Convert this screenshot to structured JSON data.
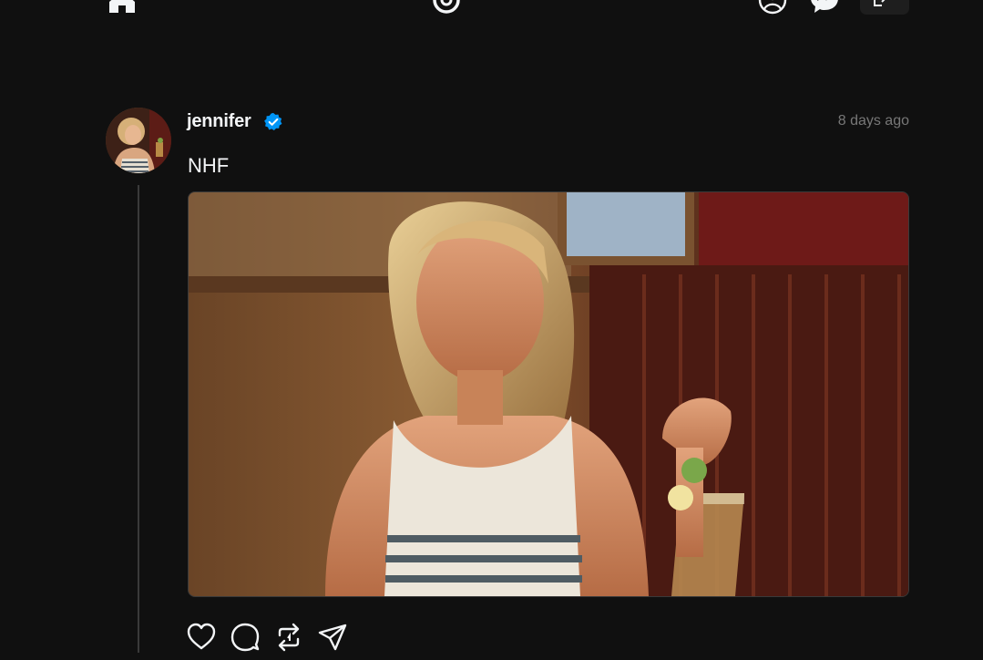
{
  "nav": {
    "icons": [
      "home-icon",
      "threads-logo",
      "profile-icon",
      "messenger-icon",
      "share-icon"
    ]
  },
  "post": {
    "username": "jennifer",
    "verified": true,
    "timestamp": "8 days ago",
    "text": "NHF",
    "media_alt": "photo",
    "actions": [
      "like-icon",
      "comment-icon",
      "repost-icon",
      "share-icon"
    ]
  },
  "colors": {
    "background": "#101010",
    "text_primary": "#f3f5f7",
    "text_secondary": "#777777",
    "verified_blue": "#0095f6",
    "divider": "#3a3a3a"
  }
}
